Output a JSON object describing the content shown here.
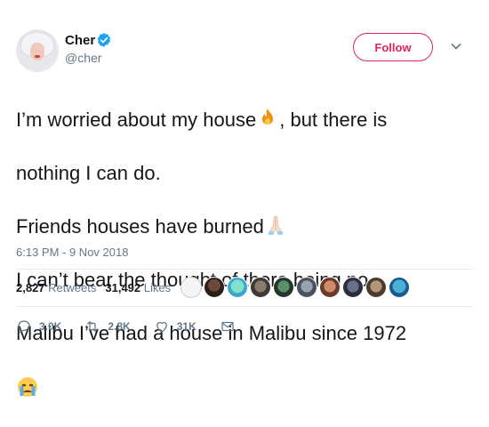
{
  "author": {
    "name": "Cher",
    "handle": "@cher",
    "verified": true
  },
  "follow_button": {
    "label": "Follow",
    "accent": "#e0245e"
  },
  "tweet": {
    "lines": [
      "I’m worried about my house",
      ", but there is",
      "nothing I can do.",
      "Friends houses have burned",
      "I can’t bear the thought of there being no",
      "Malibu I’ve had a house in Malibu since 1972"
    ],
    "emojis": [
      "fire-emoji",
      "folded-hands-emoji",
      "crying-face-emoji"
    ]
  },
  "timestamp": "6:13 PM - 9 Nov 2018",
  "stats": {
    "retweets_count": "2,827",
    "retweets_label": "Retweets",
    "likes_count": "31,492",
    "likes_label": "Likes"
  },
  "actions": {
    "reply_count": "3.0K",
    "retweet_count": "2.8K",
    "like_count": "31K"
  },
  "colors": {
    "text": "#14171a",
    "muted": "#657786",
    "verified": "#1da1f2",
    "divider": "#e6ecf0"
  }
}
